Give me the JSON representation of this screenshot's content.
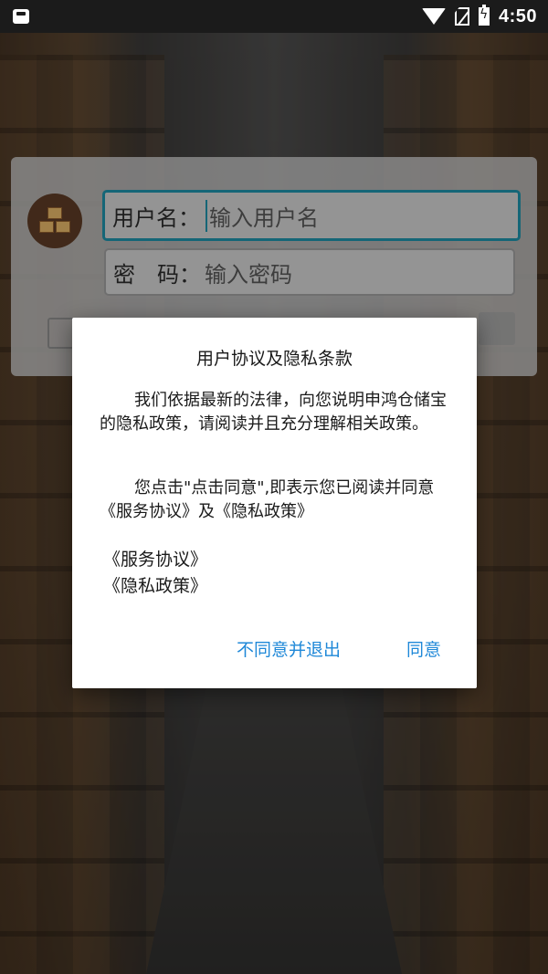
{
  "status_bar": {
    "time": "4:50",
    "icons": [
      "notification-icon",
      "wifi-icon",
      "no-sim-icon",
      "battery-charging-icon"
    ]
  },
  "login": {
    "username_label": "用户名：",
    "username_placeholder": "输入用户名",
    "password_label": "密　码：",
    "password_placeholder": "输入密码",
    "avatar_icon": "boxes-icon"
  },
  "dialog": {
    "title": "用户协议及隐私条款",
    "paragraph1": "我们依据最新的法律，向您说明申鸿仓储宝的隐私政策，请阅读并且充分理解相关政策。",
    "paragraph2": "您点击\"点击同意\",即表示您已阅读并同意《服务协议》及《隐私政策》",
    "link_service": "《服务协议》",
    "link_privacy": "《隐私政策》",
    "disagree_button": "不同意并退出",
    "agree_button": "同意",
    "accent_color": "#1f88d8"
  }
}
